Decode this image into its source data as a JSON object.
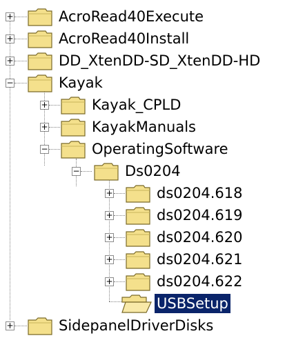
{
  "tree": {
    "items": [
      {
        "label": "AcroRead40Execute",
        "toggle": "+",
        "selected": false
      },
      {
        "label": "AcroRead40Install",
        "toggle": "+",
        "selected": false
      },
      {
        "label": "DD_XtenDD-SD_XtenDD-HD",
        "toggle": "+",
        "selected": false
      },
      {
        "label": "Kayak",
        "toggle": "−",
        "selected": false
      },
      {
        "label": "Kayak_CPLD",
        "toggle": "+",
        "selected": false
      },
      {
        "label": "KayakManuals",
        "toggle": "+",
        "selected": false
      },
      {
        "label": "OperatingSoftware",
        "toggle": "−",
        "selected": false
      },
      {
        "label": "Ds0204",
        "toggle": "−",
        "selected": false
      },
      {
        "label": "ds0204.618",
        "toggle": "+",
        "selected": false
      },
      {
        "label": "ds0204.619",
        "toggle": "+",
        "selected": false
      },
      {
        "label": "ds0204.620",
        "toggle": "+",
        "selected": false
      },
      {
        "label": "ds0204.621",
        "toggle": "+",
        "selected": false
      },
      {
        "label": "ds0204.622",
        "toggle": "+",
        "selected": false
      },
      {
        "label": "USBSetup",
        "toggle": "",
        "selected": true
      },
      {
        "label": "SidepanelDriverDisks",
        "toggle": "+",
        "selected": false
      }
    ],
    "folder_color": "#f4e08c",
    "selection_color": "#0a246a"
  }
}
